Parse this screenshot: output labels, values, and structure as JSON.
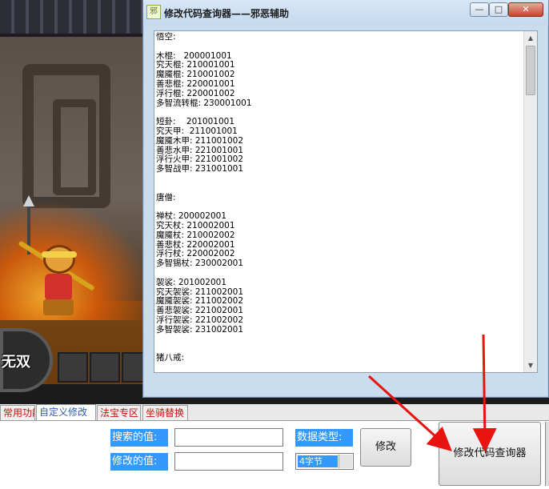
{
  "window": {
    "title": "修改代码查询器——邪恶辅助",
    "icon_text": "邪",
    "minimize_glyph": "—",
    "maximize_glyph": "□",
    "close_glyph": "✕"
  },
  "code_text": "悟空:\n\n木棍:   200001001\n究天棍: 210001001\n魔魇棍: 210001002\n善悲棍: 220001001\n浮行棍: 220001002\n多智流转棍: 230001001\n\n短卦:    201001001\n究天甲:  211001001\n魔魇木甲: 211001002\n善悲水甲: 221001001\n浮行火甲: 221001002\n多智战甲: 231001001\n\n\n唐僧:\n\n禅杖: 200002001\n究天杖: 210002001\n魔魇杖: 210002002\n善悲杖: 220002001\n浮行杖: 220002002\n多智锡杖: 230002001\n\n袈裟: 201002001\n究天袈裟: 211002001\n魔魇袈裟: 211002002\n善悲袈裟: 221002001\n浮行袈裟: 221002002\n多智袈裟: 231002001\n\n\n猪八戒:",
  "game": {
    "skill_label": "无双"
  },
  "tabs": [
    {
      "label": "常用功能",
      "active": false
    },
    {
      "label": "自定义修改",
      "active": true
    },
    {
      "label": "法宝专区",
      "active": false
    },
    {
      "label": "坐骑替换",
      "active": false
    }
  ],
  "form": {
    "search_label": "搜索的值:",
    "search_value": "",
    "modify_label": "修改的值:",
    "modify_value": "",
    "datatype_label": "数据类型:",
    "datatype_value": "4字节",
    "modify_button": "修改",
    "open_query_button": "修改代码查询器"
  },
  "colors": {
    "highlight": "#3399ff",
    "tab_text": "#c8100a",
    "active_tab_text": "#2b5fb0",
    "arrow": "#e8130f"
  }
}
